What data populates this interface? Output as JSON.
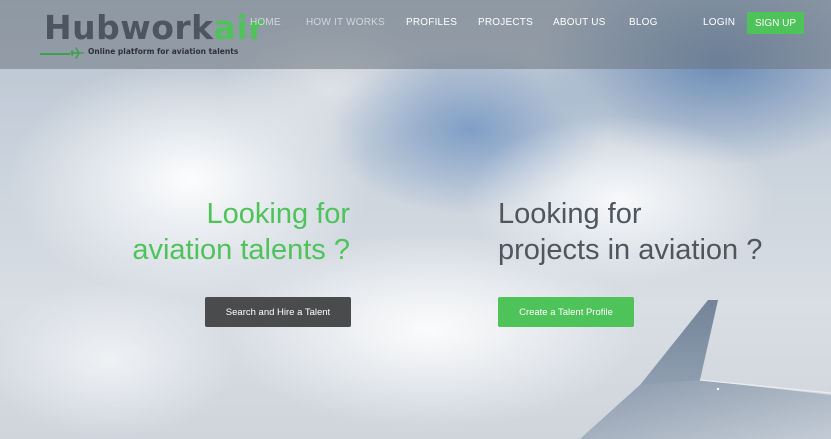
{
  "brand": {
    "name_part1": "Hubwork",
    "name_part2": "air",
    "tagline": "Online platform for aviation talents",
    "primary_color": "#4ec35a",
    "dark_color": "#4d5560"
  },
  "nav": {
    "items": [
      {
        "label": "HOME"
      },
      {
        "label": "HOW IT WORKS"
      },
      {
        "label": "PROFILES"
      },
      {
        "label": "PROJECTS"
      },
      {
        "label": "ABOUT US"
      },
      {
        "label": "BLOG"
      }
    ],
    "login_label": "LOGIN",
    "signup_label": "SIGN UP"
  },
  "hero": {
    "left": {
      "line1": "Looking for",
      "line2": "aviation talents ?",
      "button_label": "Search and Hire a Talent"
    },
    "right": {
      "line1": "Looking for",
      "line2": "projects in aviation ?",
      "button_label": "Create a Talent Profile"
    }
  },
  "icons": {
    "logo_icon": "airplane-icon",
    "background": "clouds-and-airplane-wing"
  }
}
